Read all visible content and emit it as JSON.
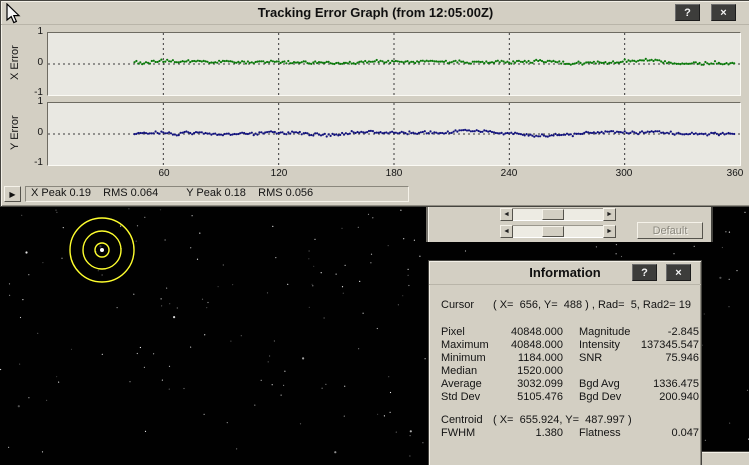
{
  "icons": {
    "help": "?",
    "close": "×",
    "play": "▶",
    "left": "◄",
    "right": "►"
  },
  "colors": {
    "reticle": "#ffff2e",
    "x_series": "#0c7a0c",
    "y_series": "#14147e"
  },
  "tracking_window": {
    "title": "Tracking Error Graph (from 12:05:00Z)",
    "x_plot": {
      "ylabel": "X Error",
      "yticks": [
        "1",
        "0",
        "-1"
      ]
    },
    "y_plot": {
      "ylabel": "Y Error",
      "yticks": [
        "1",
        "0",
        "-1"
      ]
    },
    "xticks": [
      "60",
      "120",
      "180",
      "240",
      "300",
      "360"
    ],
    "status": {
      "x_stats": "X Peak 0.19    RMS 0.064",
      "y_stats": "Y Peak 0.18    RMS 0.056"
    }
  },
  "chart_data": {
    "type": "scatter",
    "title": "Tracking Error Graph (from 12:05:00Z)",
    "xlim": [
      0,
      360
    ],
    "ylim": [
      -1,
      1
    ],
    "xticks": [
      60,
      120,
      180,
      240,
      300,
      360
    ],
    "grid": "dashed vertical lines at xticks, dashed horizontal line at 0",
    "legend": "none",
    "series": [
      {
        "name": "X Error",
        "color": "#0c7a0c",
        "x_start": 45,
        "x_end": 357,
        "x_step": 1,
        "mean": 0.07,
        "noise_sd": 0.045,
        "peak": 0.19,
        "rms": 0.064
      },
      {
        "name": "Y Error",
        "color": "#14147e",
        "x_start": 45,
        "x_end": 357,
        "x_step": 1,
        "mean": 0.02,
        "noise_sd": 0.045,
        "peak": 0.18,
        "rms": 0.056
      }
    ]
  },
  "settings_panel": {
    "default_label": "Default"
  },
  "info_window": {
    "title": "Information",
    "cursor_row": {
      "label": "Cursor",
      "value": "( X=  656, Y=  488 ) , Rad=  5, Rad2= 19"
    },
    "stats": [
      {
        "label": "Pixel",
        "value": "40848.000",
        "label2": "Magnitude",
        "value2": "-2.845"
      },
      {
        "label": "Maximum",
        "value": "40848.000",
        "label2": "Intensity",
        "value2": "137345.547"
      },
      {
        "label": "Minimum",
        "value": "1184.000",
        "label2": "SNR",
        "value2": "75.946"
      },
      {
        "label": "Median",
        "value": "1520.000",
        "label2": "",
        "value2": ""
      },
      {
        "label": "Average",
        "value": "3032.099",
        "label2": "Bgd Avg",
        "value2": "1336.475"
      },
      {
        "label": "Std Dev",
        "value": "5105.476",
        "label2": "Bgd Dev",
        "value2": "200.940"
      }
    ],
    "centroid_row": {
      "label": "Centroid",
      "value": "( X=  655.924, Y=  487.997 )"
    },
    "fwhm_row": {
      "label": "FWHM",
      "value": "1.380",
      "label2": "Flatness",
      "value2": "0.047"
    }
  }
}
